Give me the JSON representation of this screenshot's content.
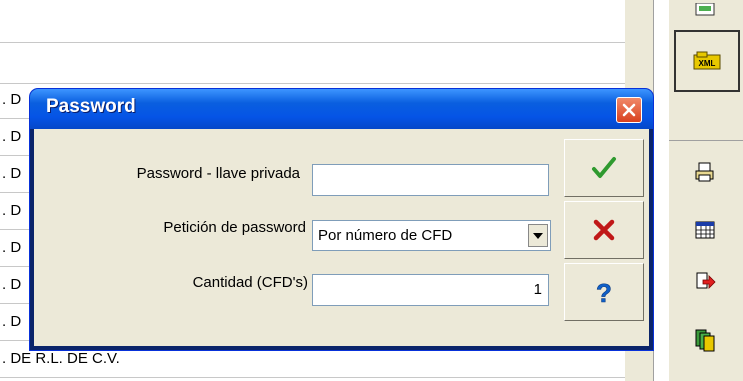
{
  "background": {
    "row_prefix": ". D",
    "last_row_text": ". DE R.L. DE C.V."
  },
  "dialog": {
    "title": "Password",
    "fields": {
      "password_label": "Password - llave privada",
      "password_value": "",
      "request_label": "Petición de password",
      "request_value": "Por número de CFD",
      "quantity_label": "Cantidad (CFD's)",
      "quantity_value": "1"
    }
  },
  "toolbar": {
    "xml_label": "XML"
  },
  "colors": {
    "titlebar": "#0554e6",
    "check": "#2f9a2f",
    "cancel": "#c01818",
    "help": "#1060c8"
  }
}
